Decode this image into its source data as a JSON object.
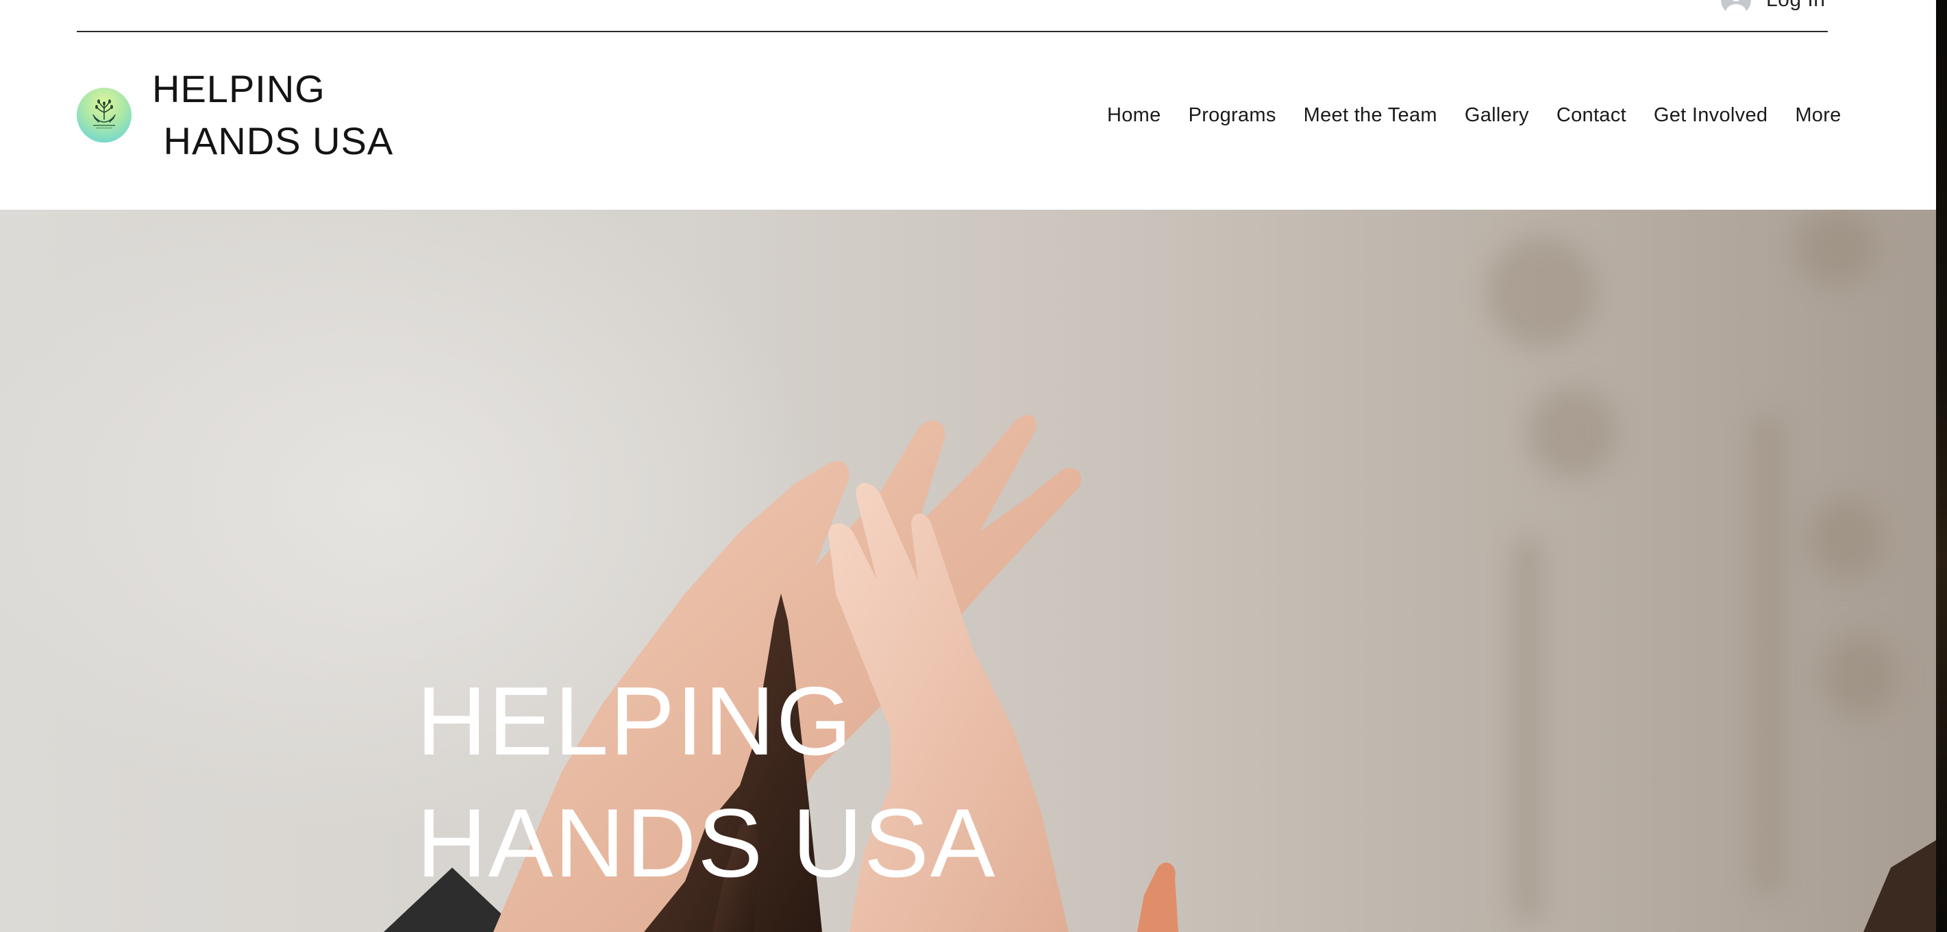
{
  "header": {
    "login_label": "Log In",
    "brand_line1": "HELPING",
    "brand_line2": " HANDS USA",
    "logo_icon": "helping-hands-logo-icon",
    "avatar_icon": "user-avatar-icon"
  },
  "nav": {
    "items": [
      {
        "label": "Home"
      },
      {
        "label": "Programs"
      },
      {
        "label": "Meet the Team"
      },
      {
        "label": "Gallery"
      },
      {
        "label": "Contact"
      },
      {
        "label": "Get Involved"
      },
      {
        "label": "More"
      }
    ]
  },
  "hero": {
    "title_line1": "HELPING",
    "title_line2": "HANDS USA",
    "image_subject": "raised hands high five"
  },
  "colors": {
    "text_dark": "#141414",
    "hero_text": "#ffffff",
    "header_bg": "#ffffff"
  }
}
